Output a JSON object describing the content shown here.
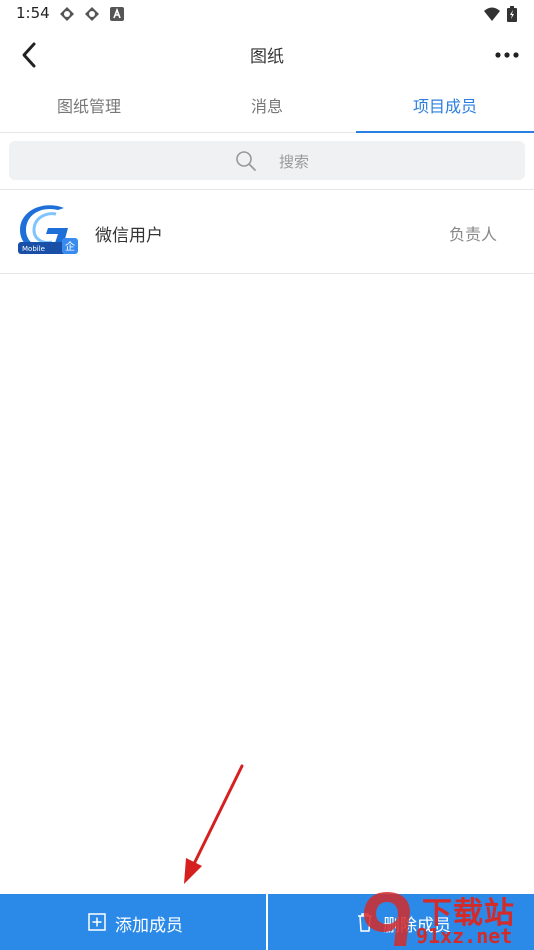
{
  "status_bar": {
    "time": "1:54",
    "icons": [
      "app-status-icon",
      "app-status-icon",
      "text-a-icon",
      "wifi-icon",
      "battery-icon"
    ]
  },
  "nav": {
    "title": "图纸",
    "back_icon": "back-chevron-icon",
    "more_icon": "more-dots-icon"
  },
  "tabs": [
    {
      "label": "图纸管理",
      "active": false
    },
    {
      "label": "消息",
      "active": false
    },
    {
      "label": "项目成员",
      "active": true
    }
  ],
  "search": {
    "placeholder": "搜索",
    "icon": "search-icon"
  },
  "members": [
    {
      "name": "微信用户",
      "role": "负责人",
      "badge": "企",
      "avatar_text": "Mobile"
    }
  ],
  "bottom_actions": {
    "add_label": "添加成员",
    "add_icon": "plus-square-icon",
    "delete_label": "删除成员",
    "delete_icon": "trash-icon"
  },
  "watermark": {
    "brand": "下载站",
    "domain": "91xz.net"
  },
  "colors": {
    "accent": "#2b7fe0",
    "bottom_bar": "#2b8ae8",
    "annotation_arrow": "#d62020"
  }
}
